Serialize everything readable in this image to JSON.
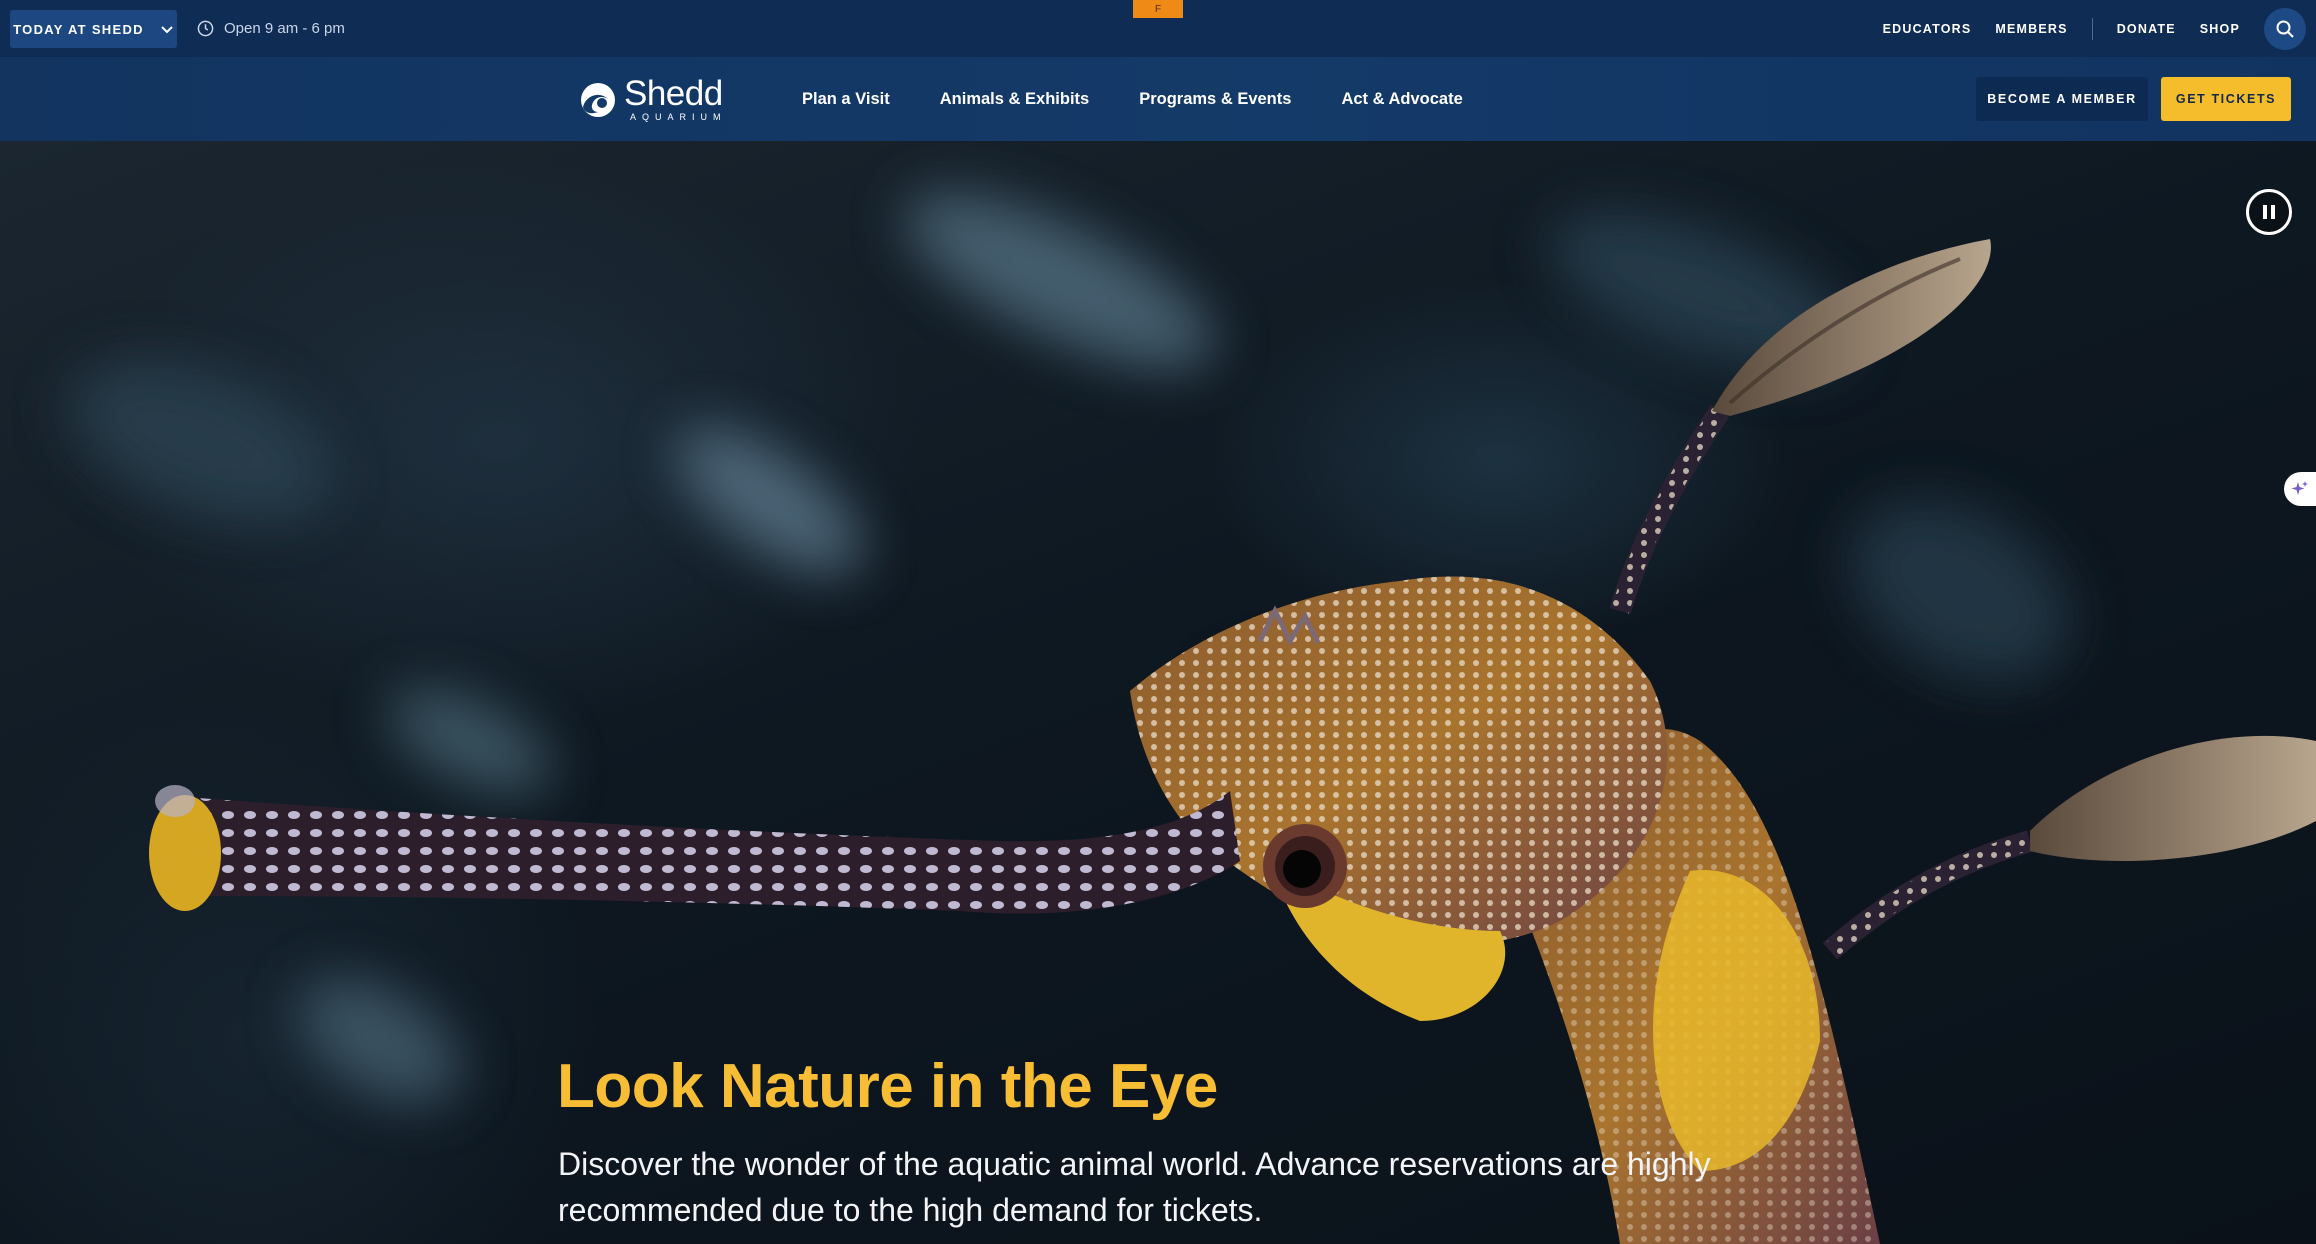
{
  "utility_bar": {
    "today_label": "TODAY AT SHEDD",
    "hours_text": "Open 9 am - 6 pm",
    "tab_marker": "F",
    "links": [
      "EDUCATORS",
      "MEMBERS",
      "DONATE",
      "SHOP"
    ],
    "search_icon": "search-icon"
  },
  "nav": {
    "logo_name": "Shedd",
    "logo_sub": "AQUARIUM",
    "items": [
      "Plan a Visit",
      "Animals & Exhibits",
      "Programs & Events",
      "Act & Advocate"
    ],
    "member_button": "BECOME A MEMBER",
    "tickets_button": "GET TICKETS"
  },
  "hero": {
    "title": "Look Nature in the Eye",
    "subtitle": "Discover the wonder of the aquatic animal world. Advance reservations are highly recommended due to the high demand for tickets.",
    "image_subject": "weedy seadragon close-up",
    "pause_icon": "pause-icon",
    "assist_icon": "sparkle-icon"
  },
  "colors": {
    "utility_bg": "#0f2c55",
    "nav_bg": "#143a69",
    "accent_yellow": "#f5bd2c",
    "title_yellow": "#f6bd35"
  }
}
